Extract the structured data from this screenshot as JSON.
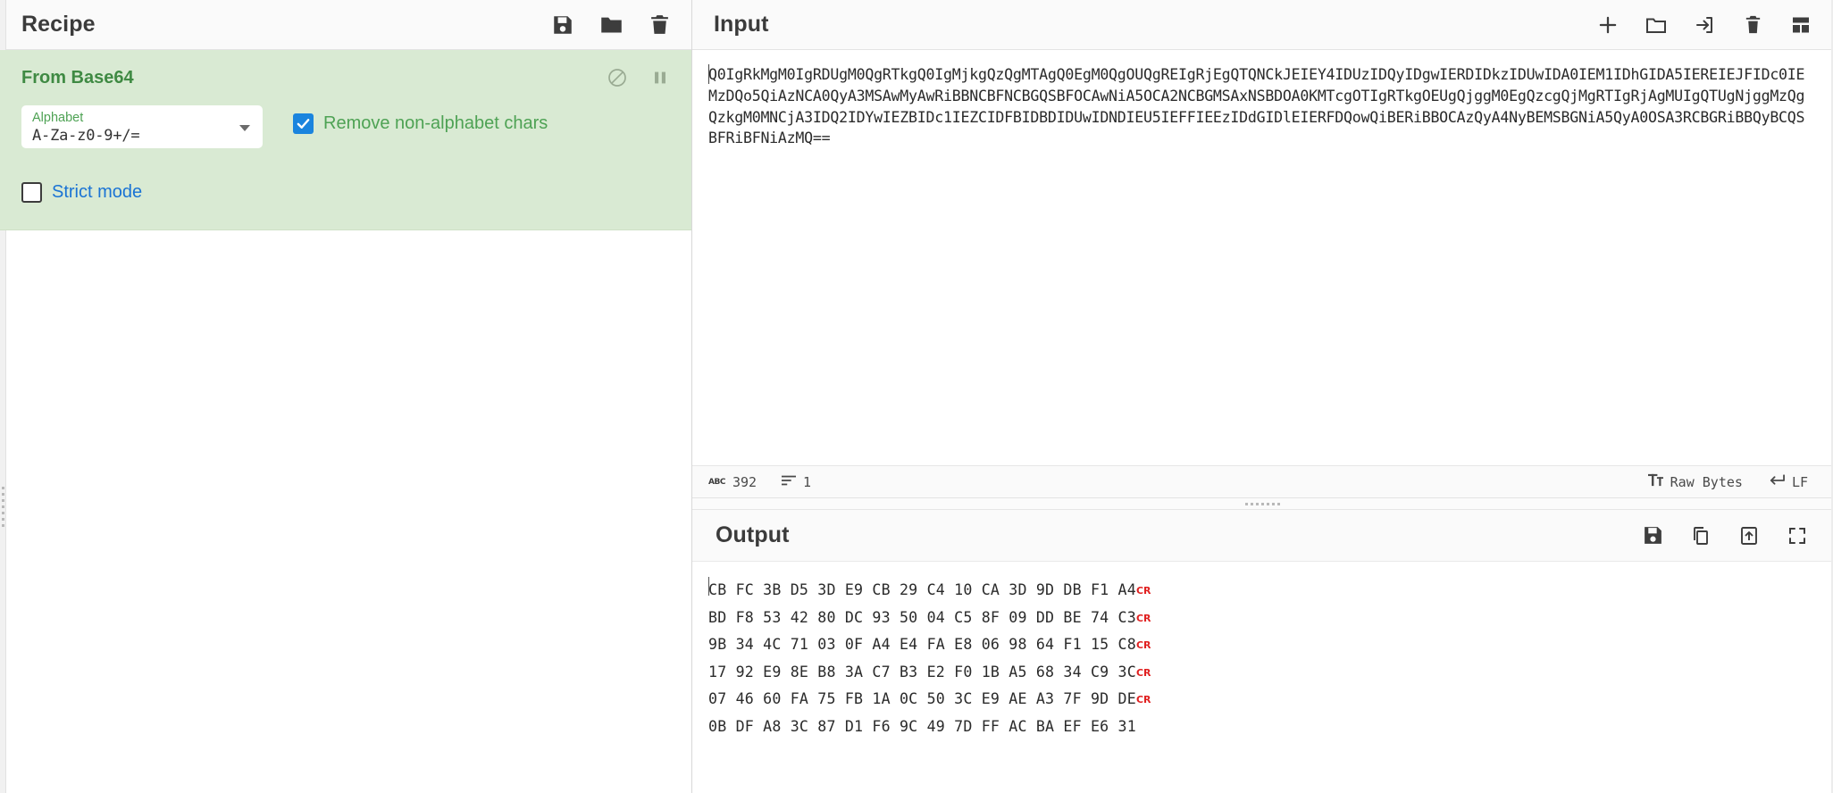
{
  "recipe": {
    "title": "Recipe",
    "header_icons": [
      {
        "name": "save-recipe-icon",
        "label": "Save recipe"
      },
      {
        "name": "load-recipe-icon",
        "label": "Load recipe"
      },
      {
        "name": "clear-recipe-icon",
        "label": "Clear recipe"
      }
    ],
    "operation": {
      "name": "From Base64",
      "controls": [
        {
          "name": "disable-operation-icon",
          "label": "Disable operation"
        },
        {
          "name": "pause-breakpoint-icon",
          "label": "Set breakpoint"
        }
      ],
      "args": {
        "alphabet": {
          "label": "Alphabet",
          "value": "A-Za-z0-9+/=",
          "caret": "chevron-down-icon"
        },
        "remove_non_alphabet": {
          "label": "Remove non-alphabet chars",
          "checked": true
        },
        "strict_mode": {
          "label": "Strict mode",
          "checked": false
        }
      }
    }
  },
  "input": {
    "title": "Input",
    "header_icons": [
      {
        "name": "add-input-tab-icon",
        "label": "Add a new input tab"
      },
      {
        "name": "open-folder-as-input-icon",
        "label": "Open folder as input"
      },
      {
        "name": "open-file-as-input-icon",
        "label": "Open file as input"
      },
      {
        "name": "clear-input-icon",
        "label": "Clear input and output"
      },
      {
        "name": "reset-pane-layout-icon",
        "label": "Reset pane layout"
      }
    ],
    "value": "Q0IgRkMgM0IgRDUgM0QgRTkgQ0IgMjkgQzQgMTAgQ0EgM0QgOUQgREIgRjEgQTQNCkJEIEY4IDUzIDQyIDgwIERDIDkzIDUwIDA0IEM1IDhGIDA5IEREIEJFIDc0IEMzDQo5QiAzNCA0QyA3MSAwMyAwRiBBNCBFNCBGQSBFOCAwNiA5OCA2NCBGMSAxNSBDOA0KMTcgOTIgRTkgOEUgQjggM0EgQzcgQjMgRTIgRjAgMUIgQTUgNjggMzQgQzkgM0MNCjA3IDQ2IDYwIEZBIDc1IEZCIDFBIDBDIDUwIDNDIEU5IEFFIEEzIDdGIDlEIERFDQowQiBERiBBOCAzQyA4NyBEMSBGNiA5QyA0OSA3RCBGRiBBQyBCQSBFRiBFNiAzMQ==",
    "status": {
      "length_icon": "abc-length-icon",
      "length": "392",
      "lines_icon": "line-count-icon",
      "lines": "1",
      "charset_icon": "font-size-icon",
      "charset": "Raw Bytes",
      "eol_icon": "enter-key-icon",
      "eol": "LF"
    }
  },
  "output": {
    "title": "Output",
    "header_icons": [
      {
        "name": "save-output-icon",
        "label": "Save output to file"
      },
      {
        "name": "copy-output-icon",
        "label": "Copy raw output to clipboard"
      },
      {
        "name": "replace-input-with-output-icon",
        "label": "Replace input with output"
      },
      {
        "name": "maximise-output-icon",
        "label": "Maximise output pane"
      }
    ],
    "hex_lines": [
      {
        "bytes": "CB FC 3B D5 3D E9 CB 29 C4 10 CA 3D 9D DB F1 A4",
        "eol": "CR"
      },
      {
        "bytes": "BD F8 53 42 80 DC 93 50 04 C5 8F 09 DD BE 74 C3",
        "eol": "CR"
      },
      {
        "bytes": "9B 34 4C 71 03 0F A4 E4 FA E8 06 98 64 F1 15 C8",
        "eol": "CR"
      },
      {
        "bytes": "17 92 E9 8E B8 3A C7 B3 E2 F0 1B A5 68 34 C9 3C",
        "eol": "CR"
      },
      {
        "bytes": "07 46 60 FA 75 FB 1A 0C 50 3C E9 AE A3 7F 9D DE",
        "eol": "CR"
      },
      {
        "bytes": "0B DF A8 3C 87 D1 F6 9C 49 7D FF AC BA EF E6 31",
        "eol": ""
      }
    ]
  },
  "colors": {
    "operation_bg": "#d9ead3",
    "operation_title": "#3f8a43",
    "arg_label": "#4ea254",
    "checkbox_checked": "#1a84de",
    "strict_label": "#1a73d4",
    "cr_marker": "#e02020"
  }
}
